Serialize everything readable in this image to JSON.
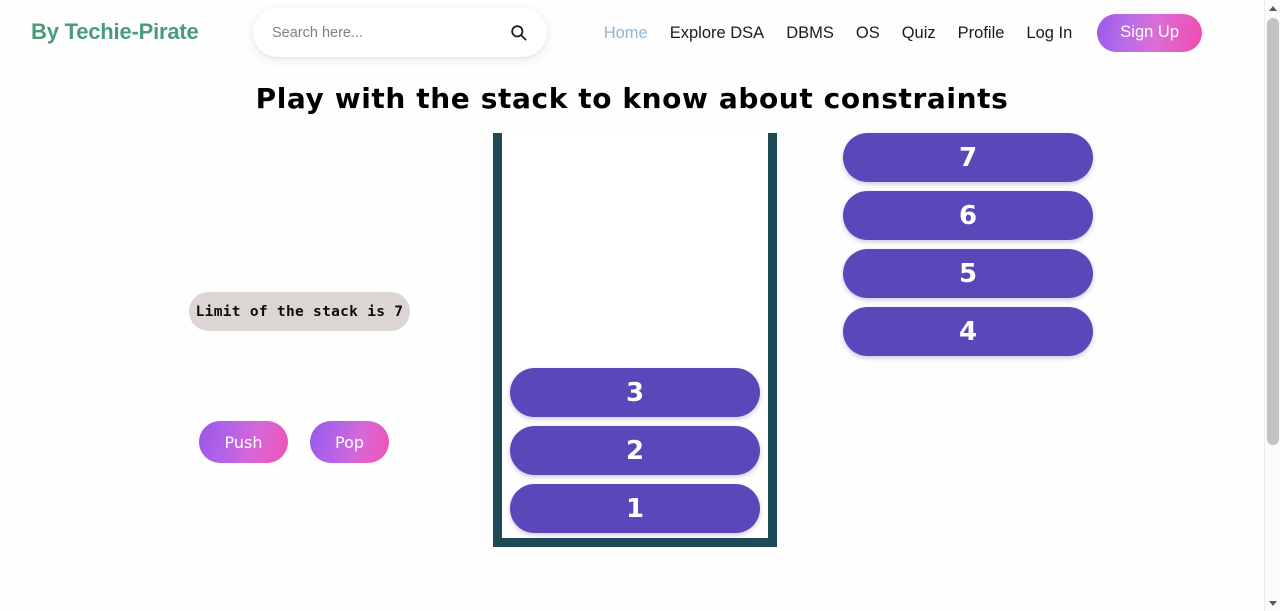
{
  "navbar": {
    "brand": "By Techie-Pirate",
    "search": {
      "placeholder": "Search here...",
      "value": "",
      "icon": "search-icon"
    },
    "links": [
      {
        "label": "Home",
        "active": true
      },
      {
        "label": "Explore DSA",
        "active": false
      },
      {
        "label": "DBMS",
        "active": false
      },
      {
        "label": "OS",
        "active": false
      },
      {
        "label": "Quiz",
        "active": false
      },
      {
        "label": "Profile",
        "active": false
      },
      {
        "label": "Log In",
        "active": false
      }
    ],
    "signup_label": "Sign Up"
  },
  "main": {
    "title": "Play with the stack to know about constraints",
    "limit_text": "Limit of the stack is 7",
    "limit_value": 7,
    "buttons": {
      "push_label": "Push",
      "pop_label": "Pop"
    },
    "stack": {
      "items_bottom_to_top": [
        "1",
        "2",
        "3"
      ],
      "items_top_to_bottom": [
        "3",
        "2",
        "1"
      ],
      "count": 3
    },
    "pending": {
      "items": [
        "7",
        "6",
        "5",
        "4"
      ],
      "count": 4
    }
  },
  "colors": {
    "brand_green": "#489d77",
    "nav_active_blue": "#90b7da",
    "block_purple": "#5b47b9",
    "container_teal": "#1e4a57",
    "limit_pill_bg": "#ddd4d4",
    "gradient_start": "#9a58e8",
    "gradient_end": "#f152b2",
    "page_bg": "#fefeff"
  },
  "scrollbar": {
    "up_arrow": "scroll-up-arrow",
    "down_arrow": "scroll-down-arrow",
    "thumb_position_percent": 3,
    "thumb_size_percent": 72
  }
}
